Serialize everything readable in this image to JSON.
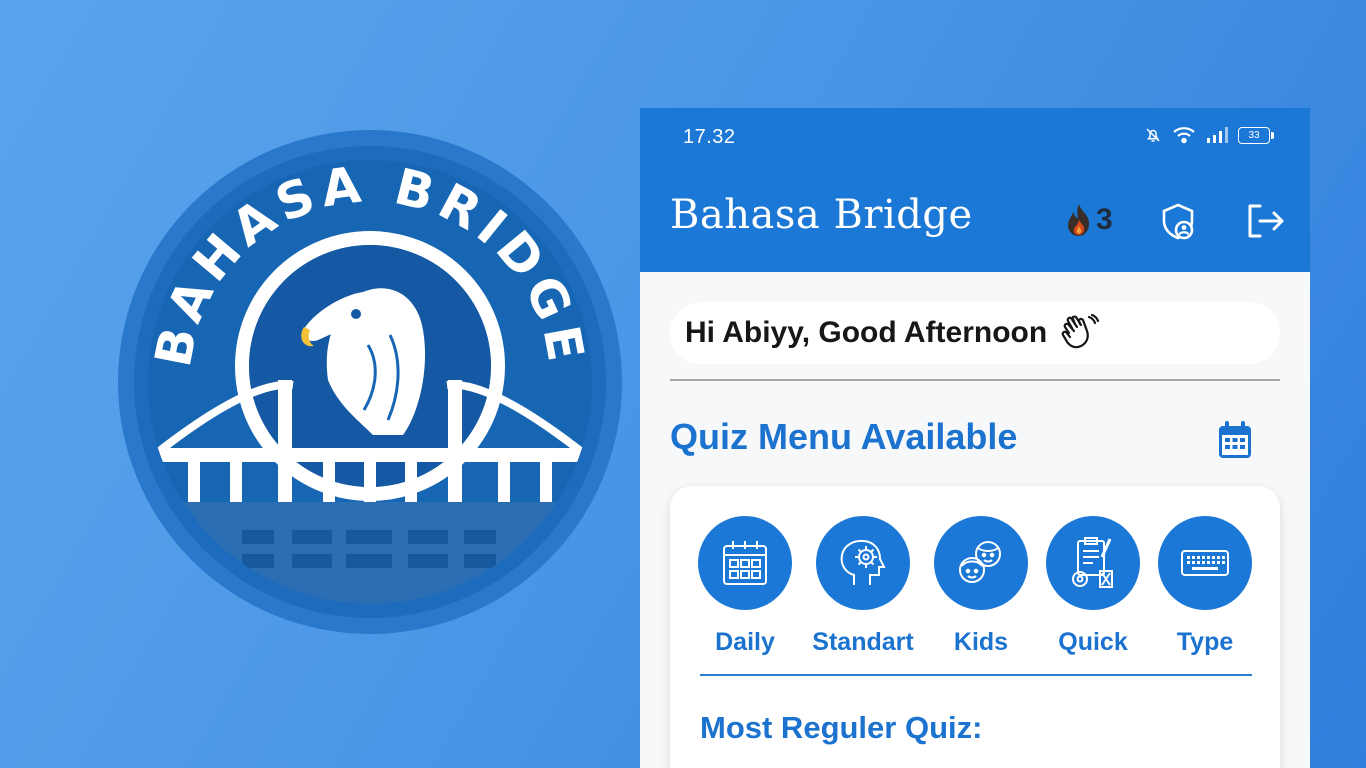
{
  "logo": {
    "top_text": "BAHASA BRIDGE",
    "colors": {
      "ring": "#2673c9",
      "disc": "#1766b4",
      "inner": "#1559a4",
      "white": "#ffffff"
    }
  },
  "status_bar": {
    "time": "17.32",
    "icons": [
      "bell-off-icon",
      "wifi-icon",
      "signal-icon",
      "battery-icon"
    ],
    "battery": "33"
  },
  "app_bar": {
    "title": "Bahasa Bridge",
    "streak_icon": "flame-icon",
    "streak_count": "3",
    "actions": [
      "shield-user-icon",
      "logout-icon"
    ],
    "color": "#1b78d6"
  },
  "greeting": {
    "text": "Hi Abiyy, Good Afternoon",
    "icon": "waving-hand-icon"
  },
  "quiz_menu": {
    "heading": "Quiz Menu Available",
    "calendar_icon": "calendar-icon",
    "items": [
      {
        "label": "Daily",
        "icon": "daily-calendar-icon"
      },
      {
        "label": "Standart",
        "icon": "brain-gear-icon"
      },
      {
        "label": "Kids",
        "icon": "kids-icon"
      },
      {
        "label": "Quick",
        "icon": "clipboard-timer-icon"
      },
      {
        "label": "Type",
        "icon": "keyboard-icon"
      }
    ],
    "regular_heading": "Most Reguler Quiz:"
  }
}
